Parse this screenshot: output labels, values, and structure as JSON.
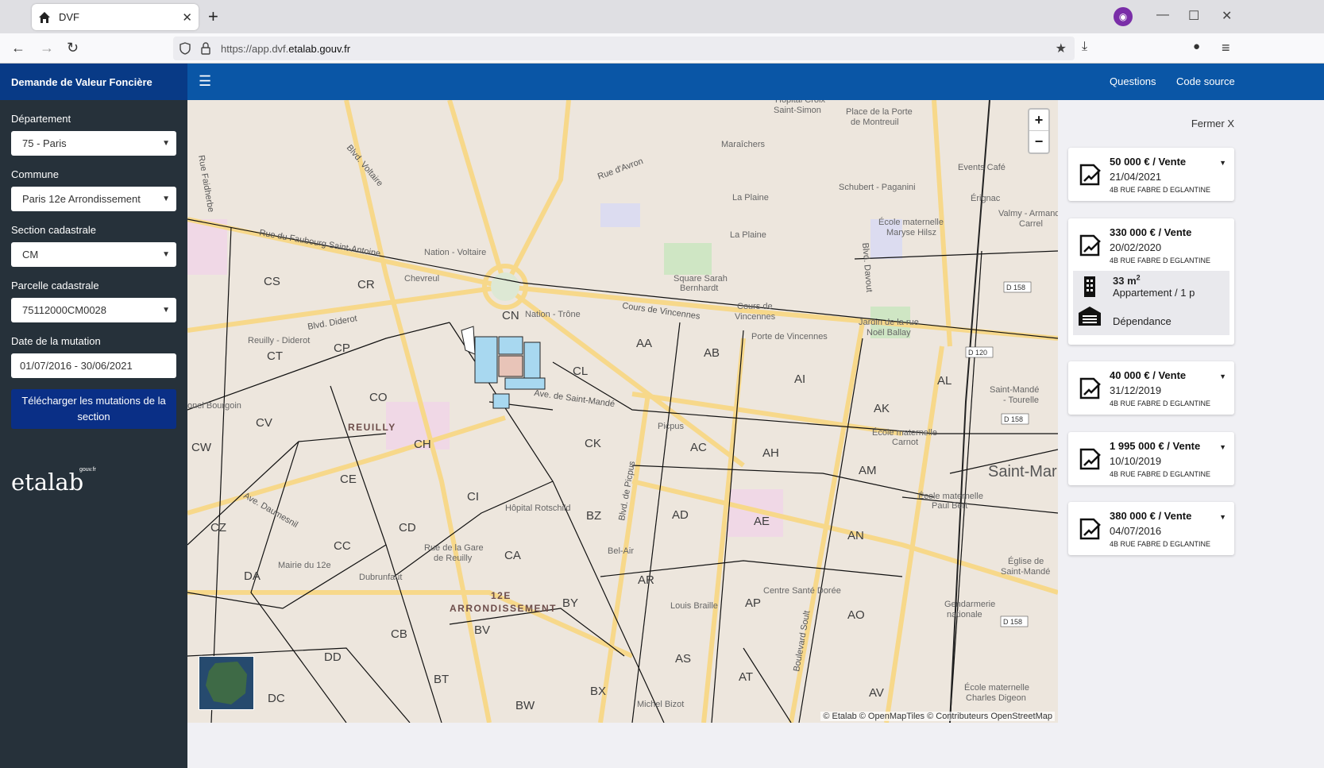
{
  "browser": {
    "tab_title": "DVF",
    "url_prefix": "https://app.dvf.",
    "url_domain": "etalab.gouv.fr"
  },
  "header": {
    "brand": "Demande de Valeur Foncière",
    "links": [
      "Questions",
      "Code source"
    ]
  },
  "filters": {
    "departement_label": "Département",
    "departement_value": "75 - Paris",
    "commune_label": "Commune",
    "commune_value": "Paris 12e Arrondissement",
    "section_label": "Section cadastrale",
    "section_value": "CM",
    "parcelle_label": "Parcelle cadastrale",
    "parcelle_value": "75112000CM0028",
    "date_label": "Date de la mutation",
    "date_value": "01/07/2016 - 30/06/2021",
    "download_label": "Télécharger les mutations de la section",
    "logo": "etalab",
    "logo_sup": "gouv.fr"
  },
  "map": {
    "attribution": "© Etalab © OpenMapTiles © Contributeurs OpenStreetMap",
    "sections": [
      "CS",
      "CR",
      "CN",
      "CP",
      "CT",
      "CO",
      "CV",
      "CW",
      "CH",
      "CE",
      "CZ",
      "CD",
      "CC",
      "CI",
      "CA",
      "DA",
      "DD",
      "CB",
      "BV",
      "BT",
      "BW",
      "DC",
      "CL",
      "CK",
      "BZ",
      "BY",
      "BX",
      "AA",
      "AB",
      "AC",
      "AD",
      "AE",
      "AH",
      "AI",
      "AK",
      "AL",
      "AM",
      "AN",
      "AO",
      "AP",
      "AR",
      "AS",
      "AT",
      "AV"
    ],
    "streets": [
      "Rue Faidherbe",
      "Blvd. Voltaire",
      "Rue d'Avron",
      "Rue du Faubourg Saint-Antoine",
      "Blvd. Diderot",
      "Cours de Vincennes",
      "Ave. de Saint-Mandé",
      "Blvd. de Picpus",
      "Blvd. Davout",
      "Boulevard Soult",
      "Ave. Daumesnil"
    ],
    "places": [
      "Nation - Voltaire",
      "Chevreul",
      "Nation - Trône",
      "Reuilly - Diderot",
      "Maraîchers",
      "La Plaine",
      "Square Sarah Bernhardt",
      "Cours de Vincennes",
      "Porte de Vincennes",
      "Picpus",
      "Hôpital Rotschild",
      "Rue de la Gare de Reuilly",
      "Mairie du 12e",
      "Dubrunfaut",
      "Bel-Air",
      "Louis Braille",
      "Centre Santé Dorée",
      "Schubert - Paganini",
      "École maternelle Maryse Hilsz",
      "Jardin de la rue Noël Ballay",
      "Events Café",
      "Valmy - Armand Carrel",
      "Saint-Mandé - Tourelle",
      "Saint-Mandé",
      "École maternelle Paul Bert",
      "Église de Saint-Mandé",
      "Gendarmerie nationale",
      "École maternelle Charles Digeon",
      "Place de la Porte de Montreuil",
      "Hôpital Croix Saint-Simon",
      "Érignac",
      "École maternelle Carnot",
      "Michel Bizot"
    ],
    "districts": [
      "REUILLY",
      "12E",
      "ARRONDISSEMENT"
    ],
    "roads": [
      "D 158",
      "D 120",
      "D 158",
      "D 158"
    ]
  },
  "panel": {
    "close_label": "Fermer X",
    "mutations": [
      {
        "price": "50 000 € / Vente",
        "date": "21/04/2021",
        "address": "4B RUE FABRE D EGLANTINE",
        "expanded": false
      },
      {
        "price": "330 000 € / Vente",
        "date": "20/02/2020",
        "address": "4B RUE FABRE D EGLANTINE",
        "expanded": true,
        "lots": [
          {
            "surface": "33 m",
            "surface_sup": "2",
            "type": "Appartement / 1 p"
          },
          {
            "surface": "",
            "surface_sup": "",
            "type": "Dépendance"
          }
        ]
      },
      {
        "price": "40 000 € / Vente",
        "date": "31/12/2019",
        "address": "4B RUE FABRE D EGLANTINE",
        "expanded": false
      },
      {
        "price": "1 995 000 € / Vente",
        "date": "10/10/2019",
        "address": "4B RUE FABRE D EGLANTINE",
        "expanded": false
      },
      {
        "price": "380 000 € / Vente",
        "date": "04/07/2016",
        "address": "4B RUE FABRE D EGLANTINE",
        "expanded": false
      }
    ]
  },
  "colors": {
    "header": "#0a56a6",
    "brand": "#083a86",
    "sidebar": "#26313a",
    "button": "#0a2f86",
    "parcel": "#a8d8f0",
    "selected_parcel": "#e8c4b8"
  }
}
